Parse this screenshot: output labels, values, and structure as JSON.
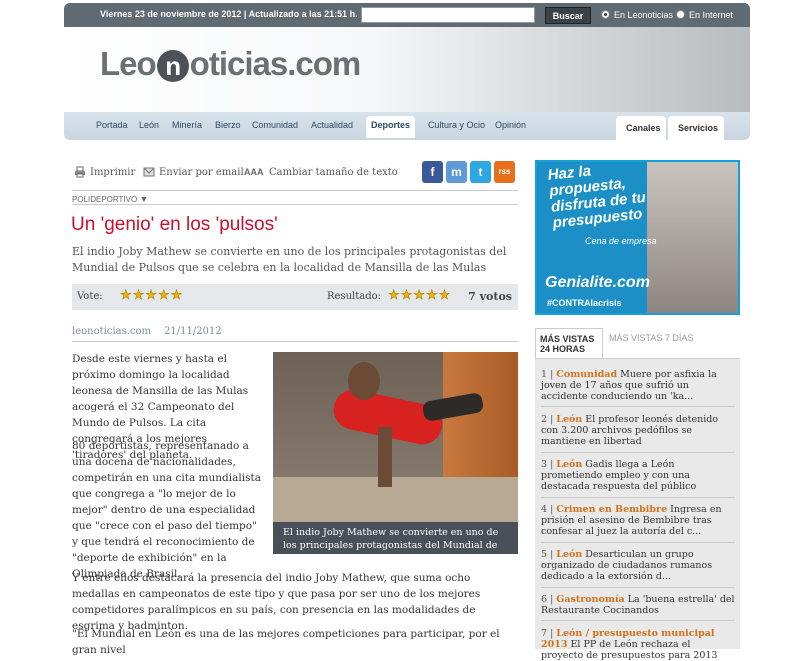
{
  "topbar": {
    "date": "Viernes 23 de noviembre de 2012 | Actualizado a las 21:51 h.",
    "search_placeholder": "",
    "search_button": "Buscar",
    "radio_leonoticias": "En Leonoticias",
    "radio_internet": "En Internet"
  },
  "header": {
    "logo_pre": "Leo",
    "logo_n": "n",
    "logo_post": "oticias.com"
  },
  "nav": {
    "items": [
      "Portada",
      "León",
      "Minería",
      "Bierzo",
      "Comunidad",
      "Actualidad",
      "Deportes",
      "Cultura y Ocio",
      "Opinión"
    ],
    "right": [
      "Canales",
      "Servicios"
    ]
  },
  "tools": {
    "print": "Imprimir",
    "email": "Enviar por email",
    "size_icon": "AAA",
    "size": "Cambiar tamaño de texto"
  },
  "social": {
    "facebook": "f",
    "meneame": "m",
    "twitter": "t",
    "rss": "rss"
  },
  "article": {
    "section": "POLIDEPORTIVO",
    "title": "Un 'genio' en los 'pulsos'",
    "summary": "El indio Joby Mathew se convierte en uno de los principales protagonistas del Mundial de Pulsos que se celebra en la localidad de Mansilla de las Mulas",
    "vote_label": "Vote:",
    "vote_stars": "★★★★★",
    "result_label": "Resultado:",
    "result_stars": "★★★★★",
    "votes": "7 votos",
    "source": "leonoticias.com",
    "date": "21/11/2012",
    "p1": "Desde este viernes y hasta el próximo domingo la localidad leonesa de Mansilla de las Mulas acogerá el 32 Campeonato del Mundo de Pulsos. La cita congregará a los mejores 'tiradores' del planeta.",
    "p2": "80 deportistas, representanado a una docena de nacionalidades, competirán en una cita mundialista que congrega a \"lo mejor de lo mejor\" dentro de una especialidad que \"crece con el paso del tiempo\" y que tendrá el reconocimiento de \"deporte de exhibición\" en la Olimpiada de Brasil.",
    "p3": "Y entre ellos destacará la presencia del indio Joby Mathew, que suma ocho medallas en campeonatos de este tipo y que pasa por ser uno de los mejores competidores paralímpicos en su país, con presencia en las modalidades de esgrima y badminton.",
    "p4": "\"El Mundial en León es una de las mejores competiciones para participar, por el gran nivel",
    "caption": "El indio Joby Mathew se convierte en uno de los principales protagonistas del Mundial de pulsos."
  },
  "ad": {
    "headline": "Haz la propuesta, disfruta de tu presupuesto",
    "sub": "Cena de empresa",
    "logo": "Genialite.com",
    "tag": "#CONTRAlacrisis"
  },
  "most_viewed": {
    "tab_active": "MÁS VISTAS 24 HORAS",
    "tab_inactive": "MÁS VISTAS 7 DÍAS",
    "items": [
      {
        "num": "1 |",
        "cat": "Comunidad",
        "text": " Muere por asfixia la joven de 17 años que sufrió un accidente conduciendo un 'ka..."
      },
      {
        "num": "2 |",
        "cat": "León",
        "text": " El profesor leonés detenido con 3.200 archivos pedófilos se mantiene en libertad"
      },
      {
        "num": "3 |",
        "cat": "León",
        "text": " Gadis llega a León prometiendo empleo y con una destacada respuesta del público"
      },
      {
        "num": "4 |",
        "cat": "Crimen en Bembibre",
        "text": " Ingresa en prisión el asesino de Bembibre tras confesar al juez la autoría del c..."
      },
      {
        "num": "5 |",
        "cat": "León",
        "text": " Desarticulan un grupo organizado de ciudadanos rumanos dedicado a la extorsión d..."
      },
      {
        "num": "6 |",
        "cat": "Gastronomía",
        "text": " La 'buena estrella' del Restaurante Cocinandos"
      },
      {
        "num": "7 |",
        "cat": "León / presupuesto municipal 2013",
        "text": " El PP de León rechaza el proyecto de presupuestos para 2013"
      }
    ]
  }
}
